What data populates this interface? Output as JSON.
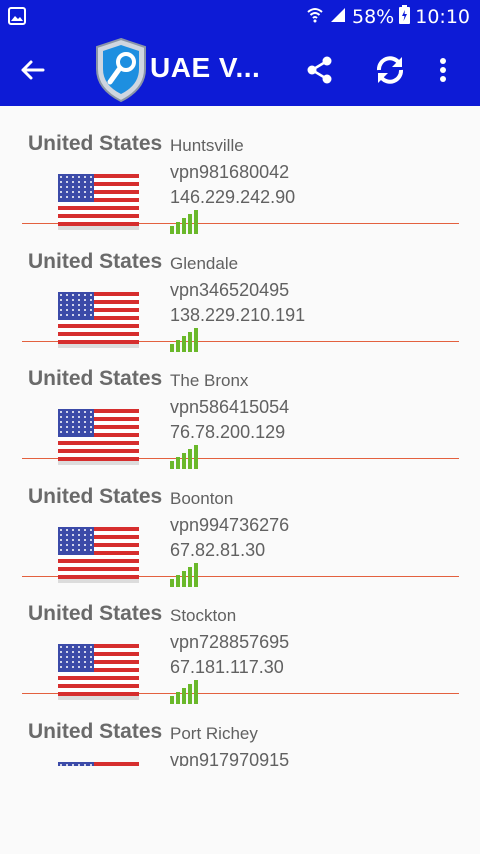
{
  "status_bar": {
    "battery": "58%",
    "time": "10:10"
  },
  "app_bar": {
    "title": "UAE V..."
  },
  "colors": {
    "primary": "#0d1bd6",
    "divider": "#e3603e",
    "signal": "#6ab82a"
  },
  "servers": [
    {
      "country": "United States",
      "city": "Huntsville",
      "host": "vpn981680042",
      "ip": "146.229.242.90"
    },
    {
      "country": "United States",
      "city": "Glendale",
      "host": "vpn346520495",
      "ip": "138.229.210.191"
    },
    {
      "country": "United States",
      "city": "The Bronx",
      "host": "vpn586415054",
      "ip": "76.78.200.129"
    },
    {
      "country": "United States",
      "city": "Boonton",
      "host": "vpn994736276",
      "ip": "67.82.81.30"
    },
    {
      "country": "United States",
      "city": "Stockton",
      "host": "vpn728857695",
      "ip": "67.181.117.30"
    },
    {
      "country": "United States",
      "city": "Port Richey",
      "host": "vpn917970915",
      "ip": ""
    }
  ]
}
